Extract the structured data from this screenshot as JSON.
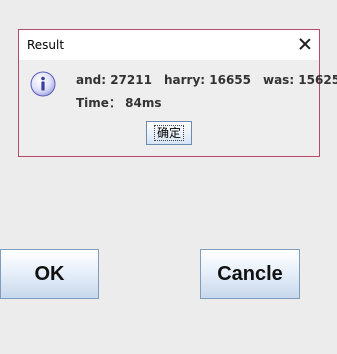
{
  "dialog": {
    "title": "Result",
    "message": {
      "item1": "and: 27211",
      "item2": "harry: 16655",
      "item3": "was: 15625",
      "time": "Time：  84ms"
    },
    "confirm_label": "确定"
  },
  "buttons": {
    "ok_label": "OK",
    "cancel_label": "Cancle"
  },
  "colors": {
    "dialog_border": "#b54a6a",
    "button_border": "#7f9db9",
    "background": "#ececec"
  }
}
